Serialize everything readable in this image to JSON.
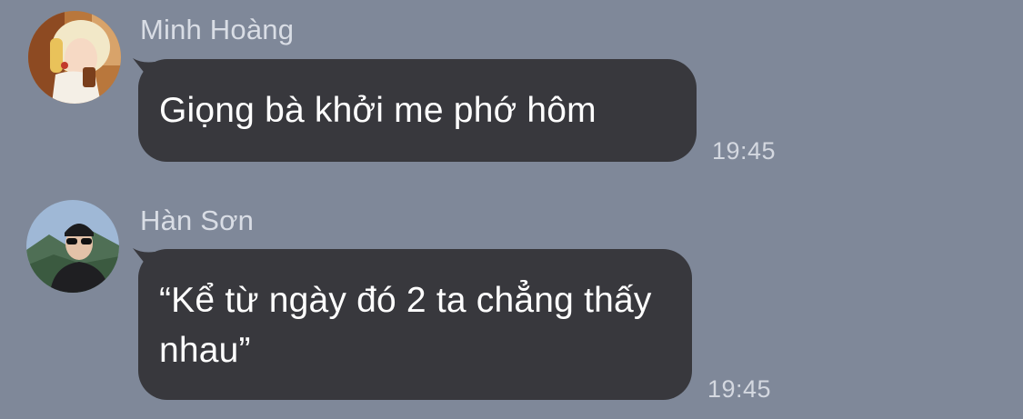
{
  "messages": [
    {
      "sender": "Minh Hoàng",
      "avatar_icon": "avatar-blonde-person",
      "text": "Giọng bà khởi me phớ hôm",
      "time": "19:45"
    },
    {
      "sender": "Hàn Sơn",
      "avatar_icon": "avatar-person-sunglasses",
      "text": "“Kể từ ngày đó 2 ta chẳng thấy nhau”",
      "time": "19:45"
    }
  ],
  "colors": {
    "background": "#7f8899",
    "bubble": "#38383d",
    "bubble_text": "#ffffff",
    "meta_text": "#d4d8e0"
  }
}
